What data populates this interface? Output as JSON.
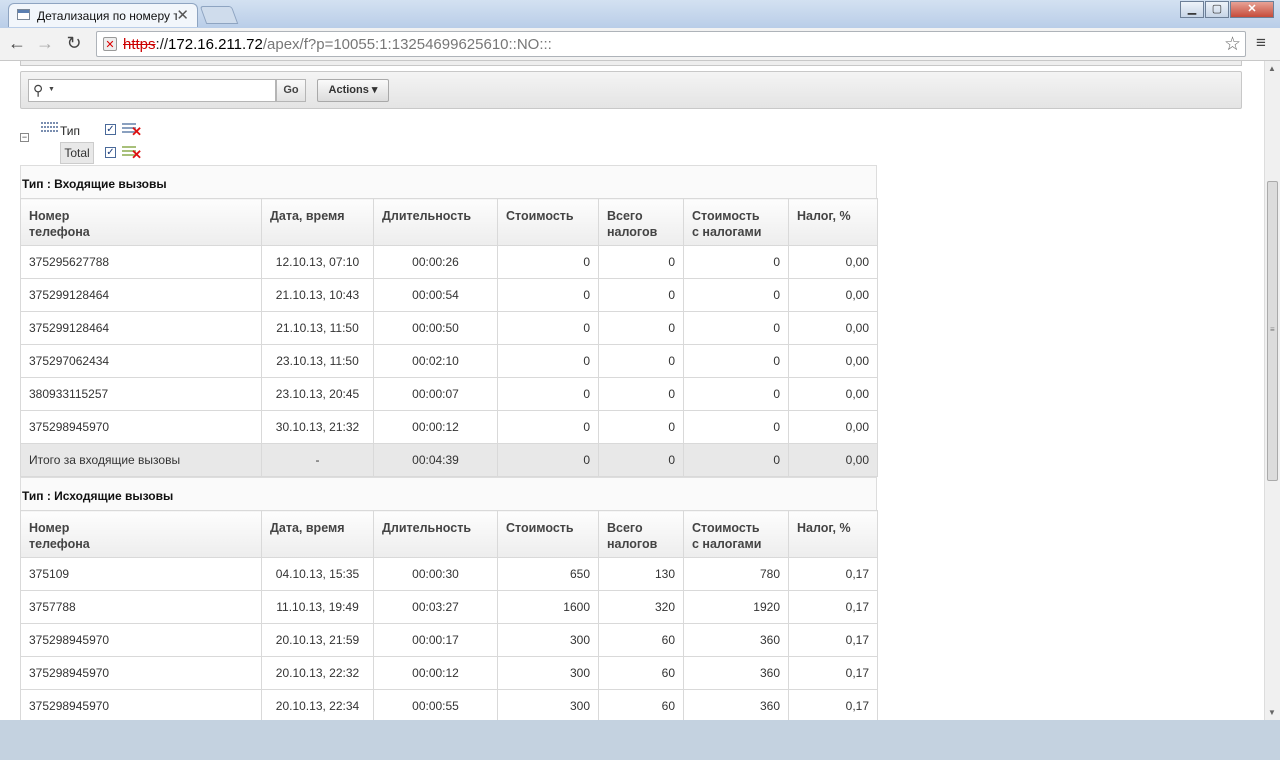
{
  "browser": {
    "tab_title": "Детализация по номеру т",
    "tab_close": "✕",
    "url_protocol": "https",
    "url_host": "172.16.211.72",
    "url_path": "/apex/f?p=10055:1:13254699625610::NO:::",
    "window_buttons": {
      "minimize": "▁",
      "maximize": "▢",
      "close": "✕"
    }
  },
  "search": {
    "placeholder": "",
    "go_label": "Go",
    "actions_label": "Actions ▾"
  },
  "control_break": {
    "group_label": "Тип",
    "total_label": "Total"
  },
  "columns": [
    "Номер телефона",
    "Дата, время",
    "Длительность",
    "Стоимость",
    "Всего налогов",
    "Стоимость с налогами",
    "Налог, %"
  ],
  "groups": [
    {
      "header": "Тип : Входящие вызовы",
      "rows": [
        [
          "375295627788",
          "12.10.13, 07:10",
          "00:00:26",
          "0",
          "0",
          "0",
          "0,00"
        ],
        [
          "375299128464",
          "21.10.13, 10:43",
          "00:00:54",
          "0",
          "0",
          "0",
          "0,00"
        ],
        [
          "375299128464",
          "21.10.13, 11:50",
          "00:00:50",
          "0",
          "0",
          "0",
          "0,00"
        ],
        [
          "375297062434",
          "23.10.13, 11:50",
          "00:02:10",
          "0",
          "0",
          "0",
          "0,00"
        ],
        [
          "380933115257",
          "23.10.13, 20:45",
          "00:00:07",
          "0",
          "0",
          "0",
          "0,00"
        ],
        [
          "375298945970",
          "30.10.13, 21:32",
          "00:00:12",
          "0",
          "0",
          "0",
          "0,00"
        ]
      ],
      "summary": [
        "Итого за входящие вызовы",
        "-",
        "00:04:39",
        "0",
        "0",
        "0",
        "0,00"
      ]
    },
    {
      "header": "Тип : Исходящие вызовы",
      "rows": [
        [
          "375109",
          "04.10.13, 15:35",
          "00:00:30",
          "650",
          "130",
          "780",
          "0,17"
        ],
        [
          "3757788",
          "11.10.13, 19:49",
          "00:03:27",
          "1600",
          "320",
          "1920",
          "0,17"
        ],
        [
          "375298945970",
          "20.10.13, 21:59",
          "00:00:17",
          "300",
          "60",
          "360",
          "0,17"
        ],
        [
          "375298945970",
          "20.10.13, 22:32",
          "00:00:12",
          "300",
          "60",
          "360",
          "0,17"
        ],
        [
          "375298945970",
          "20.10.13, 22:34",
          "00:00:55",
          "300",
          "60",
          "360",
          "0,17"
        ]
      ]
    }
  ]
}
